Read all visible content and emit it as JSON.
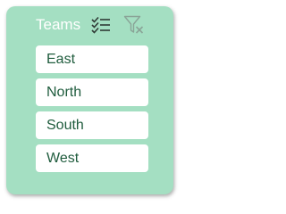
{
  "slicer": {
    "title": "Teams",
    "items": [
      {
        "label": "East"
      },
      {
        "label": "North"
      },
      {
        "label": "South"
      },
      {
        "label": "West"
      }
    ]
  },
  "icons": {
    "multi_select": "multi-select-icon",
    "clear_filter": "clear-filter-icon"
  },
  "colors": {
    "panel": "#a4dfc2",
    "item_background": "#ffffff",
    "item_text": "#1f5c3d",
    "title_text": "#ffffff"
  }
}
